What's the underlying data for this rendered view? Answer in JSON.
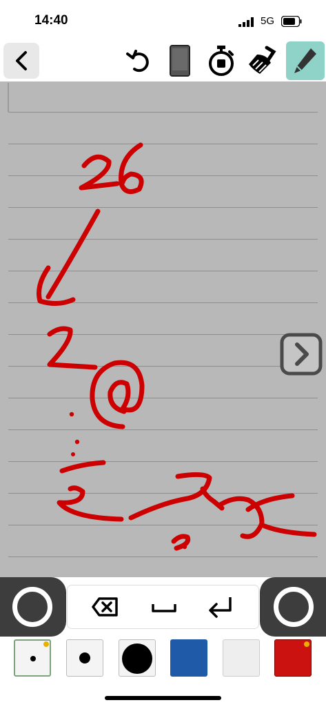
{
  "status": {
    "time": "14:40",
    "network": "5G"
  },
  "toolbar": {
    "icons": [
      "back-icon",
      "undo-icon",
      "phone-icon",
      "stopwatch-icon",
      "broom-icon",
      "pencil-icon"
    ],
    "active_tool": "pencil",
    "active_color": "#8fd3c8"
  },
  "canvas": {
    "background": "#b8b8b8",
    "ink_color": "#cc0000",
    "next_icon": "chevron-right-icon"
  },
  "input_bar": {
    "keys": [
      "backspace-icon",
      "space-icon",
      "return-icon"
    ]
  },
  "palette": {
    "swatches": [
      {
        "name": "small-dot-brush",
        "selected": true
      },
      {
        "name": "medium-dot-brush",
        "selected": false
      },
      {
        "name": "large-dot-brush",
        "selected": false
      },
      {
        "name": "blue-color",
        "color": "#1e5aa8",
        "selected": false
      },
      {
        "name": "white-color",
        "color": "#eeeeee",
        "selected": false
      },
      {
        "name": "red-color",
        "color": "#cc1111",
        "selected": true
      }
    ]
  }
}
